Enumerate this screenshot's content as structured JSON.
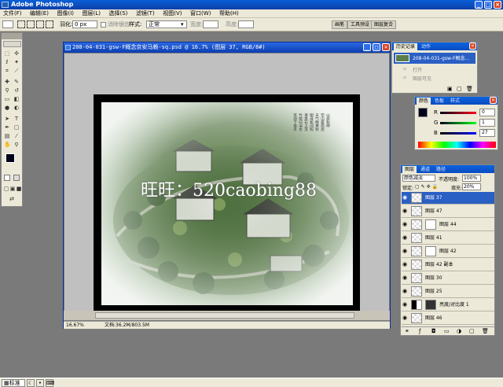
{
  "app": {
    "title": "Adobe Photoshop"
  },
  "menu": [
    "文件(F)",
    "编辑(E)",
    "图像(I)",
    "图层(L)",
    "选择(S)",
    "滤镜(T)",
    "视图(V)",
    "窗口(W)",
    "帮助(H)"
  ],
  "options": {
    "feather_label": "羽化:",
    "feather_value": "0 px",
    "antialias_label": "消除锯齿",
    "style_label": "样式:",
    "style_value": "正常",
    "width_label": "宽度:",
    "height_label": "高度:",
    "tabs": [
      "画笔",
      "工具预设",
      "图层复合"
    ]
  },
  "document": {
    "title": "208-04-031-gsw-F概念京安马赖-sq.psd @ 16.7% (图层 37, RGB/8#)",
    "zoom": "16.67%",
    "doc_size": "文档:36.2M/803.5M",
    "watermark": "旺旺：520caobing88",
    "poem_lines": [
      "山居秋暝",
      "空山新雨后",
      "天气晚来秋",
      "明月松间照",
      "清泉石上流",
      "竹喧归浣女",
      "莲动下渔舟"
    ]
  },
  "history": {
    "tabs": [
      "历史记录",
      "动作"
    ],
    "snapshot": "208-04-031-gsw-F概念...",
    "items": [
      "打开",
      "图层可见"
    ]
  },
  "color": {
    "tabs": [
      "颜色",
      "色板",
      "样式"
    ],
    "channels": [
      {
        "label": "R",
        "value": "0"
      },
      {
        "label": "G",
        "value": "1"
      },
      {
        "label": "B",
        "value": "27"
      }
    ],
    "fg_hex": "#00011b"
  },
  "layers": {
    "tabs": [
      "图层",
      "通道",
      "路径"
    ],
    "blend": "颜色减淡",
    "opacity_label": "不透明度:",
    "opacity": "100%",
    "lock_label": "锁定:",
    "fill_label": "填充:",
    "fill": "20%",
    "items": [
      {
        "name": "图层 37",
        "selected": true
      },
      {
        "name": "图层 47",
        "selected": false
      },
      {
        "name": "图层 44",
        "selected": false
      },
      {
        "name": "图层 41",
        "selected": false
      },
      {
        "name": "图层 42",
        "selected": false
      },
      {
        "name": "图层 42 副本",
        "selected": false
      },
      {
        "name": "图层 30",
        "selected": false
      },
      {
        "name": "图层 25",
        "selected": false
      },
      {
        "name": "亮度/对比度 1",
        "selected": false
      },
      {
        "name": "图层 46",
        "selected": false
      }
    ]
  },
  "taskbar": {
    "start_label": "标准"
  }
}
